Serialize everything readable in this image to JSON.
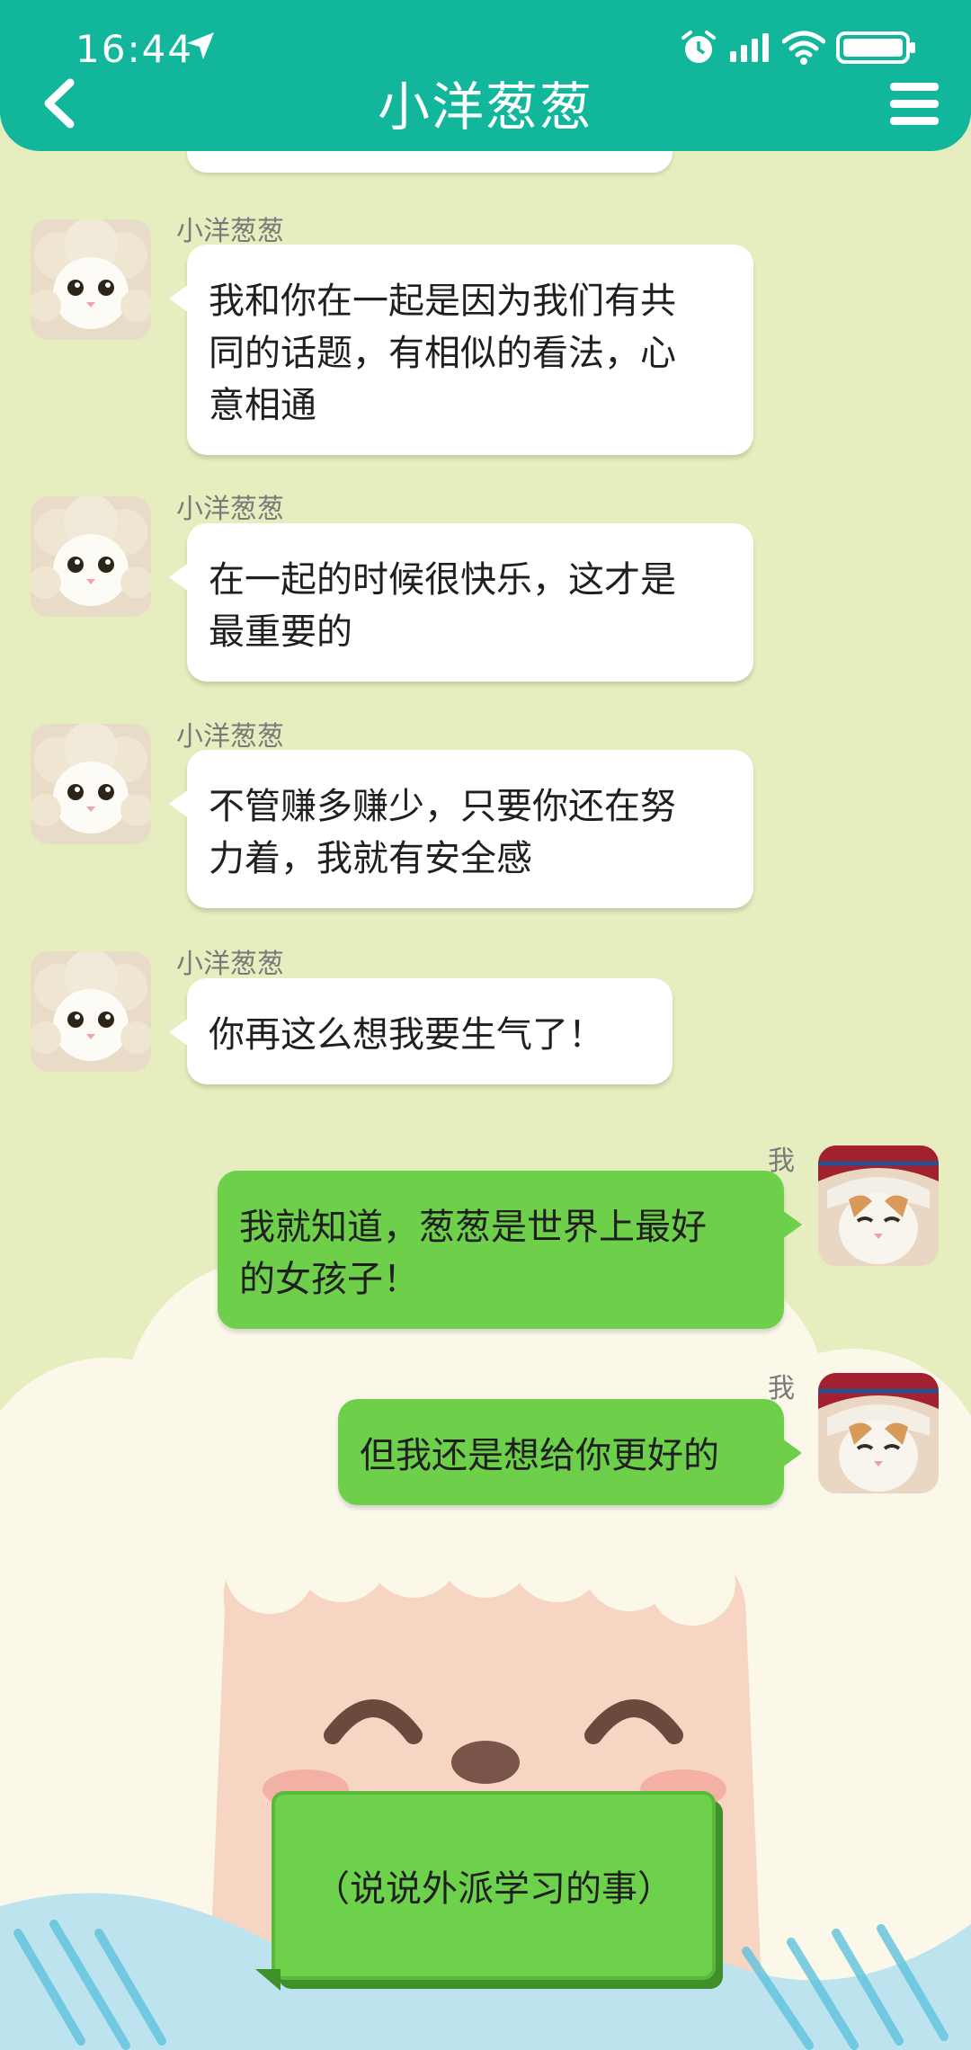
{
  "status_bar": {
    "time": "16:44",
    "icons": [
      "location-arrow-icon",
      "alarm-icon",
      "signal-icon",
      "wifi-icon",
      "battery-icon"
    ]
  },
  "header": {
    "title": "小洋葱葱",
    "back_icon": "chevron-left-icon",
    "menu_icon": "hamburger-menu-icon",
    "color": "#12b69a"
  },
  "colors": {
    "background": "#e6eebf",
    "incoming_bubble": "#ffffff",
    "outgoing_bubble": "#6dcf4a",
    "action_button": "#6dd14c"
  },
  "messages": [
    {
      "sender": "小洋葱葱",
      "direction": "in",
      "lines": [
        "我和你在一起是因为我们有共",
        "同的话题，有相似的看法，心",
        "意相通"
      ]
    },
    {
      "sender": "小洋葱葱",
      "direction": "in",
      "lines": [
        "在一起的时候很快乐，这才是",
        "最重要的"
      ]
    },
    {
      "sender": "小洋葱葱",
      "direction": "in",
      "lines": [
        "不管赚多赚少，只要你还在努",
        "力着，我就有安全感"
      ]
    },
    {
      "sender": "小洋葱葱",
      "direction": "in",
      "lines": [
        "你再这么想我要生气了！"
      ]
    },
    {
      "sender": "我",
      "direction": "out",
      "lines": [
        "我就知道，葱葱是世界上最好",
        "的女孩子！"
      ]
    },
    {
      "sender": "我",
      "direction": "out",
      "lines": [
        "但我还是想给你更好的"
      ]
    }
  ],
  "action": {
    "label": "（说说外派学习的事）"
  }
}
